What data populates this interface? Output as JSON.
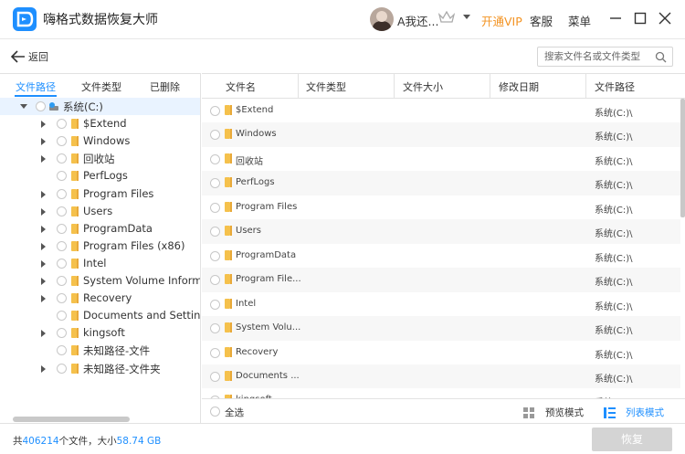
{
  "app": {
    "title": "嗨格式数据恢复大师"
  },
  "header": {
    "username": "A我还...",
    "vip_link": "开通VIP",
    "service_link": "客服",
    "menu_link": "菜单"
  },
  "toolbar": {
    "back_label": "返回",
    "search_placeholder": "搜索文件名或文件类型"
  },
  "left_tabs": [
    {
      "label": "文件路径",
      "active": true
    },
    {
      "label": "文件类型",
      "active": false
    },
    {
      "label": "已删除",
      "active": false
    }
  ],
  "tree": {
    "root": {
      "label": "系统(C:)",
      "expanded": true
    },
    "children": [
      {
        "label": "$Extend",
        "expandable": true
      },
      {
        "label": "Windows",
        "expandable": true
      },
      {
        "label": "回收站",
        "expandable": true
      },
      {
        "label": "PerfLogs",
        "expandable": false
      },
      {
        "label": "Program Files",
        "expandable": true
      },
      {
        "label": "Users",
        "expandable": true
      },
      {
        "label": "ProgramData",
        "expandable": true
      },
      {
        "label": "Program Files (x86)",
        "expandable": true
      },
      {
        "label": "Intel",
        "expandable": true
      },
      {
        "label": "System Volume Informa",
        "expandable": true
      },
      {
        "label": "Recovery",
        "expandable": true
      },
      {
        "label": "Documents and Settings",
        "expandable": false
      },
      {
        "label": "kingsoft",
        "expandable": true
      },
      {
        "label": "未知路径-文件",
        "expandable": false
      },
      {
        "label": "未知路径-文件夹",
        "expandable": true
      }
    ]
  },
  "columns": [
    "文件名",
    "文件类型",
    "文件大小",
    "修改日期",
    "文件路径"
  ],
  "rows": [
    {
      "name": "$Extend",
      "path": "系统(C:)\\"
    },
    {
      "name": "Windows",
      "path": "系统(C:)\\"
    },
    {
      "name": "回收站",
      "path": "系统(C:)\\"
    },
    {
      "name": "PerfLogs",
      "path": "系统(C:)\\"
    },
    {
      "name": "Program Files",
      "path": "系统(C:)\\"
    },
    {
      "name": "Users",
      "path": "系统(C:)\\"
    },
    {
      "name": "ProgramData",
      "path": "系统(C:)\\"
    },
    {
      "name": "Program File...",
      "path": "系统(C:)\\"
    },
    {
      "name": "Intel",
      "path": "系统(C:)\\"
    },
    {
      "name": "System Volu...",
      "path": "系统(C:)\\"
    },
    {
      "name": "Recovery",
      "path": "系统(C:)\\"
    },
    {
      "name": "Documents ...",
      "path": "系统(C:)\\"
    },
    {
      "name": "kingsoft",
      "path": "系统(C:)\\"
    }
  ],
  "footer": {
    "select_all": "全选",
    "preview_mode": "预览模式",
    "list_mode": "列表模式"
  },
  "status": {
    "prefix": "共",
    "file_count": "406214",
    "middle": "个文件，大小",
    "total_size": "58.74 GB"
  },
  "recover_button": "恢复",
  "colors": {
    "accent": "#1e8fff",
    "vip": "#f39322",
    "disabled_button": "#d4d4d4"
  }
}
